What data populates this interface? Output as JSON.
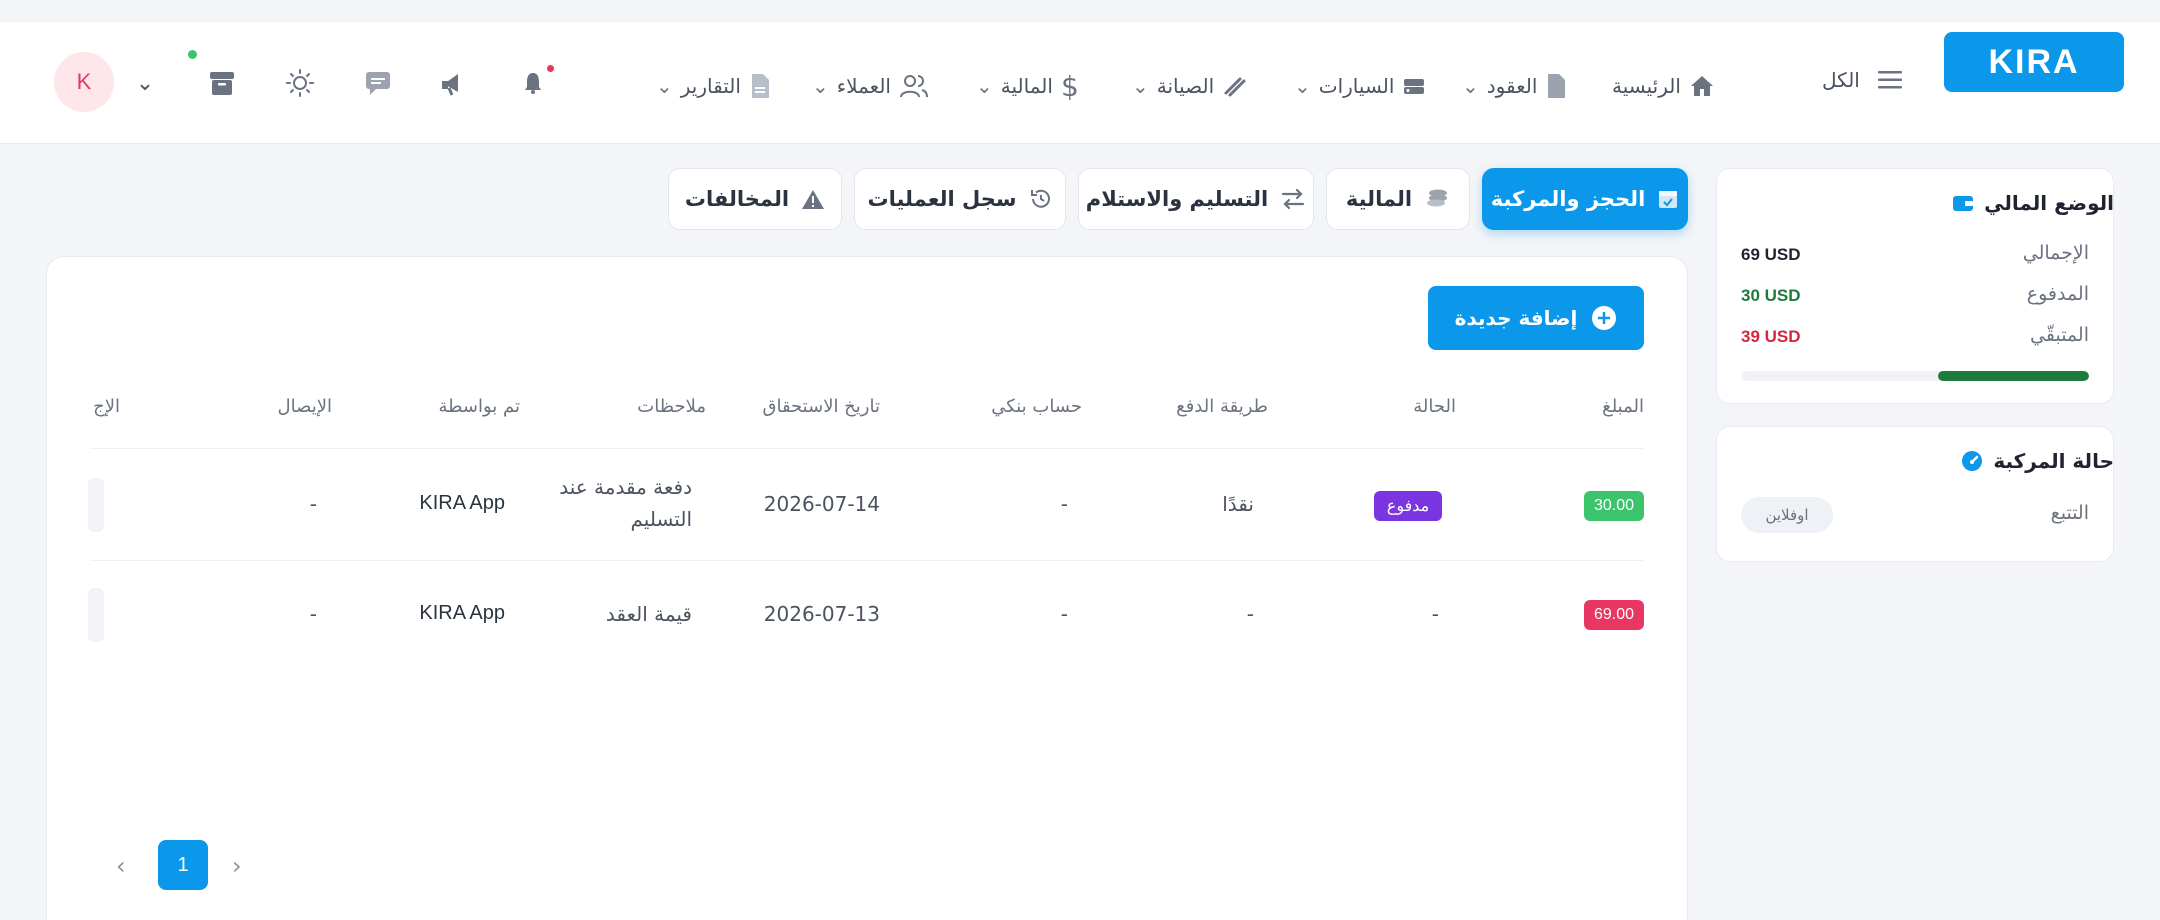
{
  "brand": {
    "logo_text": "KIRA",
    "color": "#0b98ea"
  },
  "header": {
    "all_label": "الكل",
    "nav": [
      {
        "label": "الرئيسية",
        "icon": "home-icon"
      },
      {
        "label": "العقود",
        "icon": "file-icon"
      },
      {
        "label": "السيارات",
        "icon": "car-icon"
      },
      {
        "label": "الصيانة",
        "icon": "wrench-icon"
      },
      {
        "label": "المالية",
        "icon": "dollar-icon"
      },
      {
        "label": "العملاء",
        "icon": "users-icon"
      },
      {
        "label": "التقارير",
        "icon": "report-icon"
      }
    ],
    "user_initial": "K"
  },
  "financial_status": {
    "title": "الوضع المالي",
    "rows": [
      {
        "label": "الإجمالي",
        "value": "69 USD",
        "color": "#1f2430"
      },
      {
        "label": "المدفوع",
        "value": "30 USD",
        "color": "#1f7a3d"
      },
      {
        "label": "المتبقّي",
        "value": "39 USD",
        "color": "#d6263f"
      }
    ],
    "paid_fraction": 0.435,
    "progress_color": "#1f7a3d"
  },
  "vehicle_status": {
    "title": "حالة المركبة",
    "tracking_label": "التتبع",
    "tracking_value": "اوفلاين"
  },
  "tabs": [
    {
      "label": "الحجز والمركبة",
      "icon": "calendar-icon",
      "active": true
    },
    {
      "label": "المالية",
      "icon": "coins-icon",
      "active": false
    },
    {
      "label": "التسليم والاستلام",
      "icon": "swap-icon",
      "active": false
    },
    {
      "label": "سجل العمليات",
      "icon": "history-icon",
      "active": false
    },
    {
      "label": "المخالفات",
      "icon": "warning-icon",
      "active": false
    }
  ],
  "add_button_label": "إضافة جديدة",
  "table": {
    "columns": [
      "المبلغ",
      "الحالة",
      "طريقة الدفع",
      "حساب بنكي",
      "تاريخ الاستحقاق",
      "ملاحظات",
      "تم بواسطة",
      "الإيصال",
      "الإج"
    ],
    "rows": [
      {
        "amount": "30.00",
        "amount_color": "#3cc46c",
        "status": "مدفوع",
        "status_color": "#7a34e0",
        "method": "نقدًا",
        "bank": "-",
        "due": "2026-07-14",
        "notes_1": "دفعة مقدمة عند",
        "notes_2": "التسليم",
        "by": "KIRA App",
        "receipt": "-"
      },
      {
        "amount": "69.00",
        "amount_color": "#e83763",
        "status": "-",
        "method": "-",
        "bank": "-",
        "due": "2026-07-13",
        "notes": "قيمة العقد",
        "by": "KIRA App",
        "receipt": "-"
      }
    ]
  },
  "pagination": {
    "current": "1"
  }
}
